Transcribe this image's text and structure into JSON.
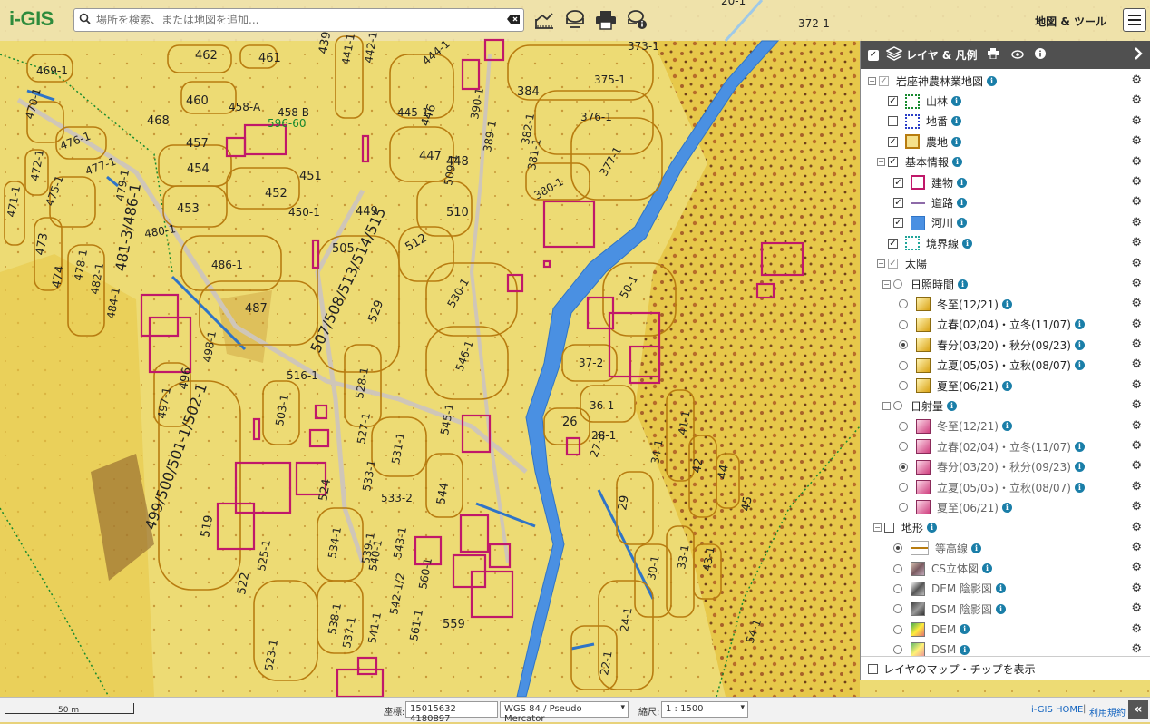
{
  "app": {
    "logo_i": "i",
    "logo_rest": "-GIS"
  },
  "search": {
    "placeholder": "場所を検索、または地図を追加..."
  },
  "toolbar": {
    "menu_label": "地図 & ツール"
  },
  "icons": {
    "search": "search-icon",
    "clear": "clear-icon",
    "measure": "measure-icon",
    "print": "print-icon",
    "info": "info-icon",
    "menu": "hamburger-icon",
    "layers": "layers-icon",
    "eye": "eye-icon",
    "gear": "gear-icon",
    "collapse": "chevron-right-icon"
  },
  "panel": {
    "title": "レイヤ & 凡例",
    "layers": [
      {
        "label": "岩座神農林業地図",
        "gear": "⚙"
      },
      {
        "label": "山林",
        "gear": "⚙"
      },
      {
        "label": "地番",
        "gear": "⚙"
      },
      {
        "label": "農地",
        "gear": "⚙"
      },
      {
        "label": "基本情報",
        "gear": "⚙"
      },
      {
        "label": "建物",
        "gear": "⚙"
      },
      {
        "label": "道路",
        "gear": "⚙"
      },
      {
        "label": "河川",
        "gear": "⚙"
      },
      {
        "label": "境界線",
        "gear": "⚙"
      },
      {
        "label": "太陽",
        "gear": "⚙"
      },
      {
        "label": "日照時間",
        "gear": "⚙"
      },
      {
        "label": "冬至(12/21)",
        "gear": "⚙"
      },
      {
        "label": "立春(02/04)・立冬(11/07)",
        "gear": "⚙"
      },
      {
        "label": "春分(03/20)・秋分(09/23)",
        "gear": "⚙"
      },
      {
        "label": "立夏(05/05)・立秋(08/07)",
        "gear": "⚙"
      },
      {
        "label": "夏至(06/21)",
        "gear": "⚙"
      },
      {
        "label": "日射量",
        "gear": "⚙"
      },
      {
        "label": "冬至(12/21)",
        "gear": "⚙"
      },
      {
        "label": "立春(02/04)・立冬(11/07)",
        "gear": "⚙"
      },
      {
        "label": "春分(03/20)・秋分(09/23)",
        "gear": "⚙"
      },
      {
        "label": "立夏(05/05)・立秋(08/07)",
        "gear": "⚙"
      },
      {
        "label": "夏至(06/21)",
        "gear": "⚙"
      },
      {
        "label": "地形",
        "gear": "⚙"
      },
      {
        "label": "等高線",
        "gear": "⚙"
      },
      {
        "label": "CS立体図",
        "gear": "⚙"
      },
      {
        "label": "DEM 陰影図",
        "gear": "⚙"
      },
      {
        "label": "DSM 陰影図",
        "gear": "⚙"
      },
      {
        "label": "DEM",
        "gear": "⚙"
      },
      {
        "label": "DSM",
        "gear": "⚙"
      }
    ],
    "footer_label": "レイヤのマップ・チップを表示"
  },
  "map": {
    "parcel_labels": [
      "469-1",
      "470-1",
      "476-1",
      "477-1",
      "472-1",
      "475-1",
      "479-1",
      "471-1",
      "473",
      "474",
      "478-1",
      "482-1",
      "484-1",
      "480-1",
      "481-3/486-1",
      "462",
      "461",
      "460",
      "458-A",
      "458-B",
      "468",
      "457",
      "454",
      "453",
      "452",
      "451",
      "450-1",
      "441-1",
      "442-1",
      "439",
      "444-1",
      "445-1",
      "446",
      "447",
      "448",
      "449",
      "509-1",
      "510",
      "505",
      "486-1",
      "487",
      "512",
      "507/508/513/514/515",
      "530-1",
      "529",
      "546-1",
      "528-1",
      "516-1",
      "503-1",
      "497-1",
      "496",
      "498-1",
      "499/500/501-1/502-1",
      "519",
      "524",
      "525-1",
      "522",
      "523-1",
      "534-1",
      "538-1",
      "539-1",
      "540-1",
      "543-1",
      "541-1",
      "537-1",
      "542-1/2",
      "560-1",
      "561-1",
      "559",
      "533-1",
      "533-2",
      "531-1",
      "527-1",
      "544",
      "545-1",
      "373-1",
      "375-1",
      "376-1",
      "377-1",
      "380-1",
      "381-1",
      "382-1",
      "384",
      "389-1",
      "390-1",
      "50-1",
      "37-2",
      "36-1",
      "26",
      "28-1",
      "27-3",
      "29",
      "41-1",
      "34-1",
      "42",
      "44",
      "45",
      "30-1",
      "33-1",
      "43-1",
      "24-1",
      "22-1",
      "20-1",
      "372-1",
      "54-1",
      "596-60"
    ]
  },
  "status": {
    "scale_bar_label": "50 m",
    "coord_label": "座標:",
    "coords": "15015632 4180897",
    "crs": "WGS 84 / Pseudo Mercator",
    "scale_label": "縮尺:",
    "scale_value": "1 : 1500",
    "home_link": "i-GIS HOME",
    "separator": "|",
    "terms_link": "利用規約"
  }
}
